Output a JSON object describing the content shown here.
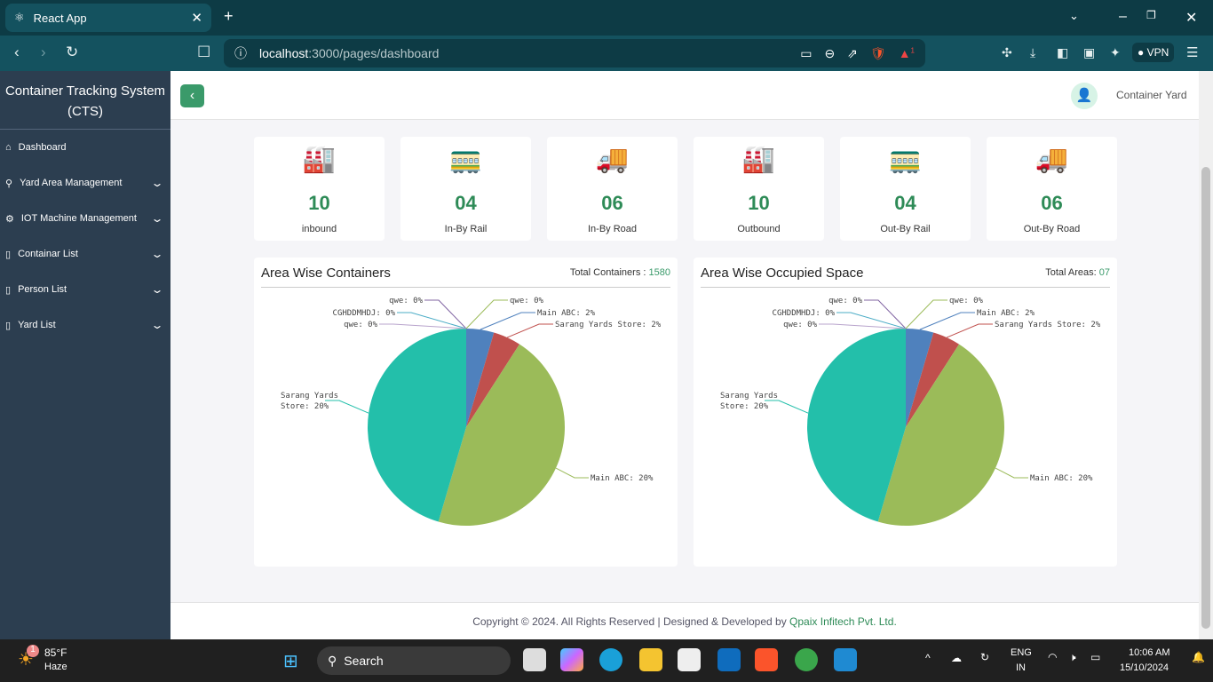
{
  "browser": {
    "tab_title": "React App",
    "url_host": "localhost",
    "url_path": ":3000/pages/dashboard",
    "vpn": "VPN",
    "badge": "1"
  },
  "sidebar": {
    "brand": "Container Tracking System (CTS)",
    "items": [
      {
        "label": "Dashboard",
        "icon": "home-icon"
      },
      {
        "label": "Yard Area Management",
        "icon": "location-icon"
      },
      {
        "label": "IOT Machine Management",
        "icon": "gear-icon"
      },
      {
        "label": "Containar List",
        "icon": "container-icon"
      },
      {
        "label": "Person List",
        "icon": "container-icon"
      },
      {
        "label": "Yard List",
        "icon": "container-icon"
      }
    ]
  },
  "header": {
    "user": "Container Yard"
  },
  "stats": [
    {
      "value": "10",
      "label": "inbound",
      "icon": "🏭"
    },
    {
      "value": "04",
      "label": "In-By Rail",
      "icon": "🚃"
    },
    {
      "value": "06",
      "label": "In-By Road",
      "icon": "🚚"
    },
    {
      "value": "10",
      "label": "Outbound",
      "icon": "🏭"
    },
    {
      "value": "04",
      "label": "Out-By Rail",
      "icon": "🚃"
    },
    {
      "value": "06",
      "label": "Out-By Road",
      "icon": "🚚"
    }
  ],
  "chart_data": [
    {
      "type": "pie",
      "title": "Area Wise Containers",
      "total_label": "Total Containers :",
      "total_value": "1580",
      "slices": [
        {
          "label": "Main ABC",
          "value": 2,
          "color": "#4f81bd"
        },
        {
          "label": "Sarang Yards Store",
          "value": 2,
          "color": "#c0504d"
        },
        {
          "label": "Main ABC",
          "value": 20,
          "color": "#9bbb59"
        },
        {
          "label": "Sarang Yards Store",
          "value": 20,
          "color": "#23bfaa"
        },
        {
          "label": "qwe",
          "value": 0,
          "color": "#8064a2"
        },
        {
          "label": "CGHDDMHDJ",
          "value": 0,
          "color": "#4bacc6"
        },
        {
          "label": "qwe",
          "value": 0,
          "color": "#b8a4cc"
        },
        {
          "label": "qwe",
          "value": 0,
          "color": "#9bbb59"
        }
      ],
      "data_labels": [
        "Main ABC: 2%",
        "Sarang Yards Store: 2%",
        "Main ABC: 20%",
        "Sarang Yards Store: 20%",
        "qwe: 0%",
        "CGHDDMHDJ: 0%",
        "qwe: 0%",
        "qwe: 0%"
      ]
    },
    {
      "type": "pie",
      "title": "Area Wise Occupied Space",
      "total_label": "Total Areas:",
      "total_value": "07",
      "slices": [
        {
          "label": "Main ABC",
          "value": 2,
          "color": "#4f81bd"
        },
        {
          "label": "Sarang Yards Store",
          "value": 2,
          "color": "#c0504d"
        },
        {
          "label": "Main ABC",
          "value": 20,
          "color": "#9bbb59"
        },
        {
          "label": "Sarang Yards Store",
          "value": 20,
          "color": "#23bfaa"
        },
        {
          "label": "qwe",
          "value": 0,
          "color": "#8064a2"
        },
        {
          "label": "CGHDDMHDJ",
          "value": 0,
          "color": "#4bacc6"
        },
        {
          "label": "qwe",
          "value": 0,
          "color": "#b8a4cc"
        },
        {
          "label": "qwe",
          "value": 0,
          "color": "#9bbb59"
        }
      ],
      "data_labels": [
        "Main ABC: 2%",
        "Sarang Yards Store: 2%",
        "Main ABC: 20%",
        "Sarang Yards Store: 20%",
        "qwe: 0%",
        "CGHDDMHDJ: 0%",
        "qwe: 0%",
        "qwe: 0%"
      ]
    }
  ],
  "footer": {
    "text": "Copyright © 2024. All Rights Reserved | Designed & Developed by ",
    "company": "Qpaix Infitech Pvt. Ltd."
  },
  "taskbar": {
    "temp": "85°F",
    "weather": "Haze",
    "search": "Search",
    "lang1": "ENG",
    "lang2": "IN",
    "time": "10:06 AM",
    "date": "15/10/2024",
    "weather_badge": "1"
  }
}
